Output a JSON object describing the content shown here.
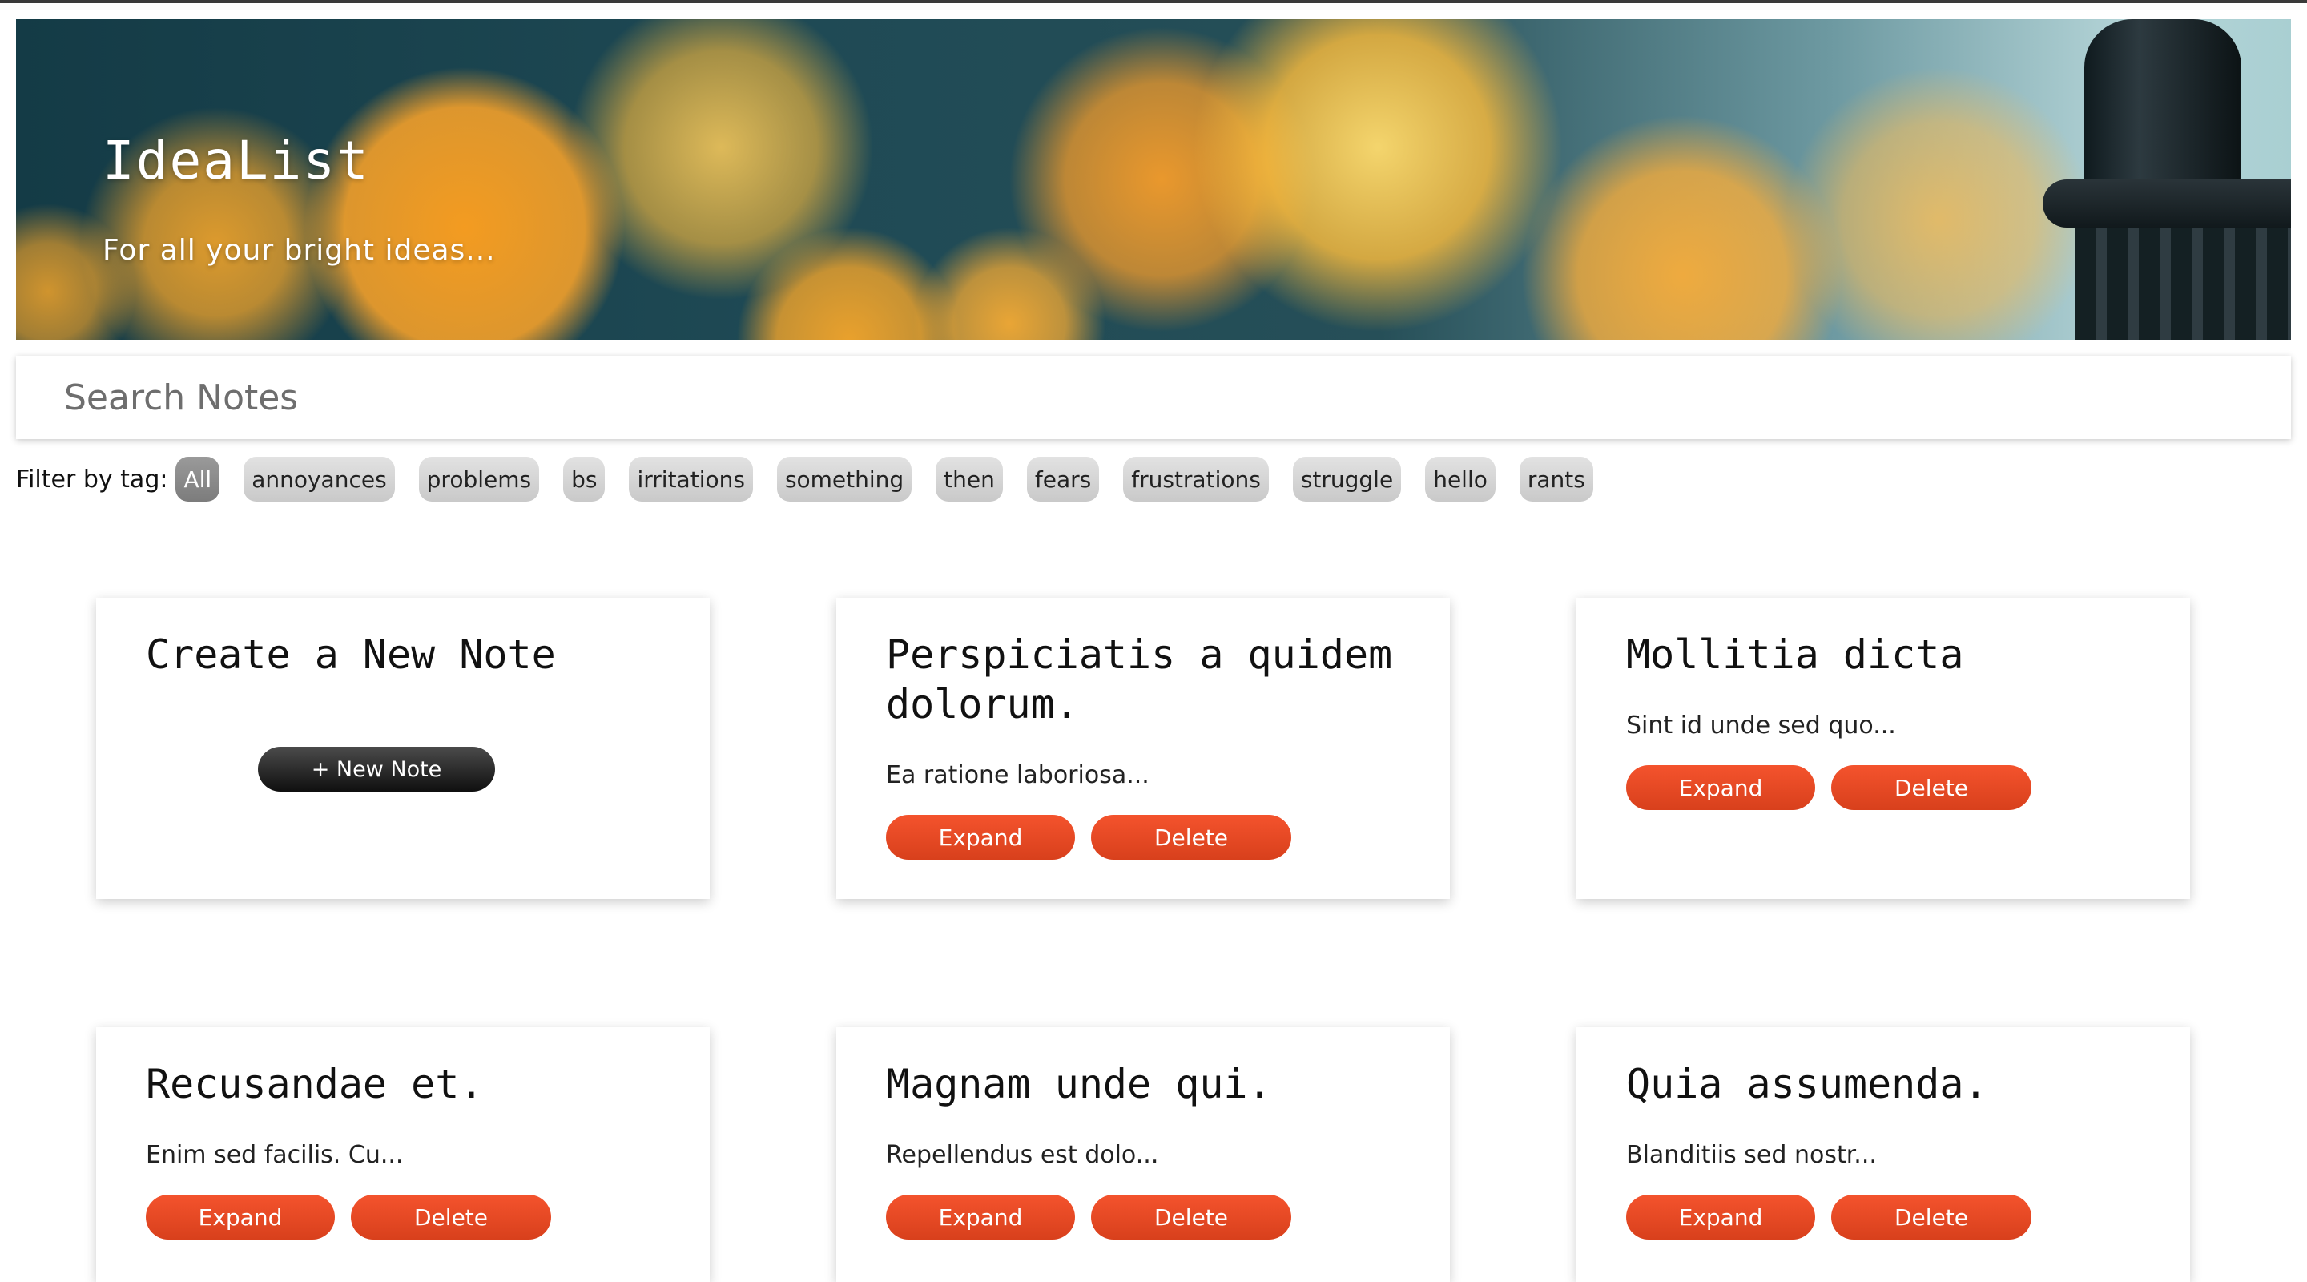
{
  "header": {
    "title": "IdeaList",
    "subtitle": "For all your bright ideas..."
  },
  "search": {
    "placeholder": "Search Notes",
    "value": ""
  },
  "filter": {
    "label": "Filter by tag:",
    "tags": [
      "All",
      "annoyances",
      "problems",
      "bs",
      "irritations",
      "something",
      "then",
      "fears",
      "frustrations",
      "struggle",
      "hello",
      "rants"
    ],
    "selected": "All"
  },
  "new_note_card": {
    "title": "Create a New Note",
    "button_label": "+ New Note"
  },
  "notes": [
    {
      "title": "Perspiciatis a quidem dolorum.",
      "preview": "Ea ratione laboriosa..."
    },
    {
      "title": "Mollitia dicta",
      "preview": "Sint id unde sed quo..."
    },
    {
      "title": "Recusandae et.",
      "preview": "Enim sed facilis. Cu..."
    },
    {
      "title": "Magnam unde qui.",
      "preview": "Repellendus est dolo..."
    },
    {
      "title": "Quia assumenda.",
      "preview": "Blanditiis sed nostr..."
    }
  ],
  "note_actions": {
    "expand_label": "Expand",
    "delete_label": "Delete"
  },
  "colors": {
    "accent": "#e84a24",
    "active_tag": "#8a8a8a",
    "tag": "#d4d4d4",
    "new_note_button": "#1e1e1e"
  }
}
